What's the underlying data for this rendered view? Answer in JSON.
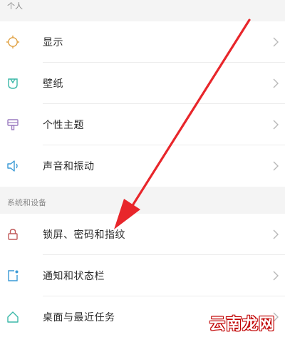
{
  "sections": [
    {
      "header": "个人",
      "items": [
        {
          "label": "显示",
          "icon": "brightness-icon"
        },
        {
          "label": "壁纸",
          "icon": "wallpaper-icon"
        },
        {
          "label": "个性主题",
          "icon": "theme-brush-icon"
        },
        {
          "label": "声音和振动",
          "icon": "speaker-icon"
        }
      ]
    },
    {
      "header": "系统和设备",
      "items": [
        {
          "label": "锁屏、密码和指纹",
          "icon": "lock-icon"
        },
        {
          "label": "通知和状态栏",
          "icon": "notification-icon"
        },
        {
          "label": "桌面与最近任务",
          "icon": "home-icon"
        }
      ]
    }
  ],
  "watermark": "云南龙网",
  "colors": {
    "display_icon": "#e0a040",
    "wallpaper_icon": "#3bb8a8",
    "theme_icon": "#9b7cc0",
    "sound_icon": "#3a9ad6",
    "lock_icon": "#c05a5a",
    "notify_icon": "#3a9ad6",
    "home_icon": "#3bb8a8",
    "arrow": "#e8262b"
  }
}
